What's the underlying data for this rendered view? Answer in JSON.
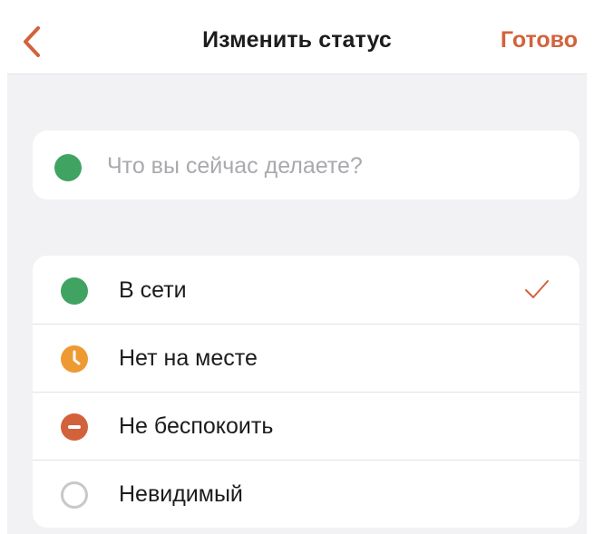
{
  "header": {
    "title": "Изменить статус",
    "done_label": "Готово"
  },
  "status_input": {
    "placeholder": "Что вы сейчас делаете?",
    "value": ""
  },
  "statuses": [
    {
      "label": "В сети",
      "icon": "online-dot-icon",
      "color": "#40a362",
      "selected": true
    },
    {
      "label": "Нет на месте",
      "icon": "clock-icon",
      "color": "#ee9a33",
      "selected": false
    },
    {
      "label": "Не беспокоить",
      "icon": "do-not-disturb-icon",
      "color": "#d2623c",
      "selected": false
    },
    {
      "label": "Невидимый",
      "icon": "invisible-circle-icon",
      "color": "#c7c7cc",
      "selected": false
    }
  ],
  "colors": {
    "accent": "#d2623c",
    "background": "#f2f2f4"
  }
}
